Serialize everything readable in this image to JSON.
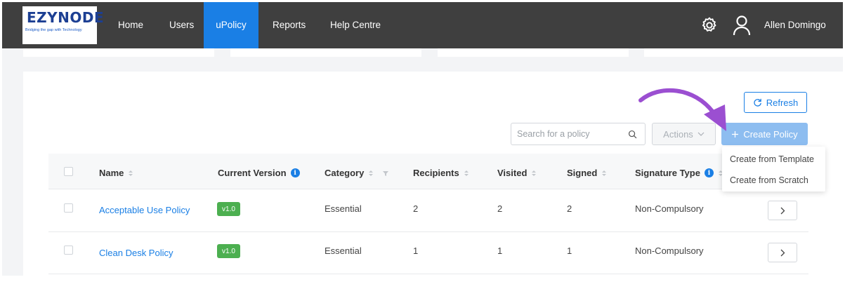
{
  "brand": {
    "name": "EZYNODE",
    "tagline": "Bridging the gap with Technology"
  },
  "nav": {
    "items": [
      {
        "label": "Home"
      },
      {
        "label": "Users"
      },
      {
        "label": "uPolicy",
        "active": true
      },
      {
        "label": "Reports"
      },
      {
        "label": "Help Centre"
      }
    ],
    "user_name": "Allen Domingo"
  },
  "toolbar": {
    "refresh_label": "Refresh",
    "search_placeholder": "Search for a policy",
    "actions_label": "Actions",
    "create_label": "Create Policy",
    "create_menu": [
      {
        "label": "Create from Template"
      },
      {
        "label": "Create from Scratch"
      }
    ]
  },
  "table": {
    "columns": [
      {
        "label": "Name"
      },
      {
        "label": "Current Version"
      },
      {
        "label": "Category"
      },
      {
        "label": "Recipients"
      },
      {
        "label": "Visited"
      },
      {
        "label": "Signed"
      },
      {
        "label": "Signature Type"
      }
    ],
    "rows": [
      {
        "name": "Acceptable Use Policy",
        "version": "v1.0",
        "category": "Essential",
        "recipients": "2",
        "visited": "2",
        "signed": "2",
        "signature_type": "Non-Compulsory"
      },
      {
        "name": "Clean Desk Policy",
        "version": "v1.0",
        "category": "Essential",
        "recipients": "1",
        "visited": "1",
        "signed": "1",
        "signature_type": "Non-Compulsory"
      }
    ]
  },
  "colors": {
    "nav_bg": "#3f3f3f",
    "nav_active": "#1a7fe5",
    "accent": "#1a7fe5",
    "badge_green": "#4caf50",
    "annotation_arrow": "#9b4fd1"
  },
  "icons": {
    "settings": "gear-icon",
    "user": "user-icon",
    "refresh": "refresh-icon",
    "search": "search-icon",
    "actions": "chevron-down-icon",
    "create": "plus-icon",
    "row_open": "chevron-right-icon"
  }
}
